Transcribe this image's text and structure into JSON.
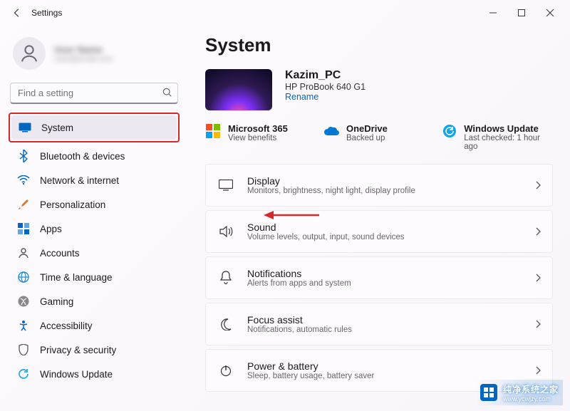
{
  "titlebar": {
    "title": "Settings"
  },
  "user": {
    "name": "User Name",
    "email": "user@email.com"
  },
  "search": {
    "placeholder": "Find a setting"
  },
  "sidebar": {
    "items": [
      {
        "label": "System",
        "selected": true,
        "highlighted": true
      },
      {
        "label": "Bluetooth & devices"
      },
      {
        "label": "Network & internet"
      },
      {
        "label": "Personalization"
      },
      {
        "label": "Apps"
      },
      {
        "label": "Accounts"
      },
      {
        "label": "Time & language"
      },
      {
        "label": "Gaming"
      },
      {
        "label": "Accessibility"
      },
      {
        "label": "Privacy & security"
      },
      {
        "label": "Windows Update"
      }
    ]
  },
  "page": {
    "title": "System",
    "pc": {
      "name": "Kazim_PC",
      "model": "HP ProBook 640 G1",
      "rename": "Rename"
    },
    "status": [
      {
        "title": "Microsoft 365",
        "sub": "View benefits"
      },
      {
        "title": "OneDrive",
        "sub": "Backed up"
      },
      {
        "title": "Windows Update",
        "sub": "Last checked: 1 hour ago"
      }
    ],
    "items": [
      {
        "title": "Display",
        "sub": "Monitors, brightness, night light, display profile"
      },
      {
        "title": "Sound",
        "sub": "Volume levels, output, input, sound devices"
      },
      {
        "title": "Notifications",
        "sub": "Alerts from apps and system"
      },
      {
        "title": "Focus assist",
        "sub": "Notifications, automatic rules"
      },
      {
        "title": "Power & battery",
        "sub": "Sleep, battery usage, battery saver"
      }
    ]
  },
  "watermark": {
    "cn": "纯净系统之家",
    "url": "www.ycwjzy.com"
  }
}
